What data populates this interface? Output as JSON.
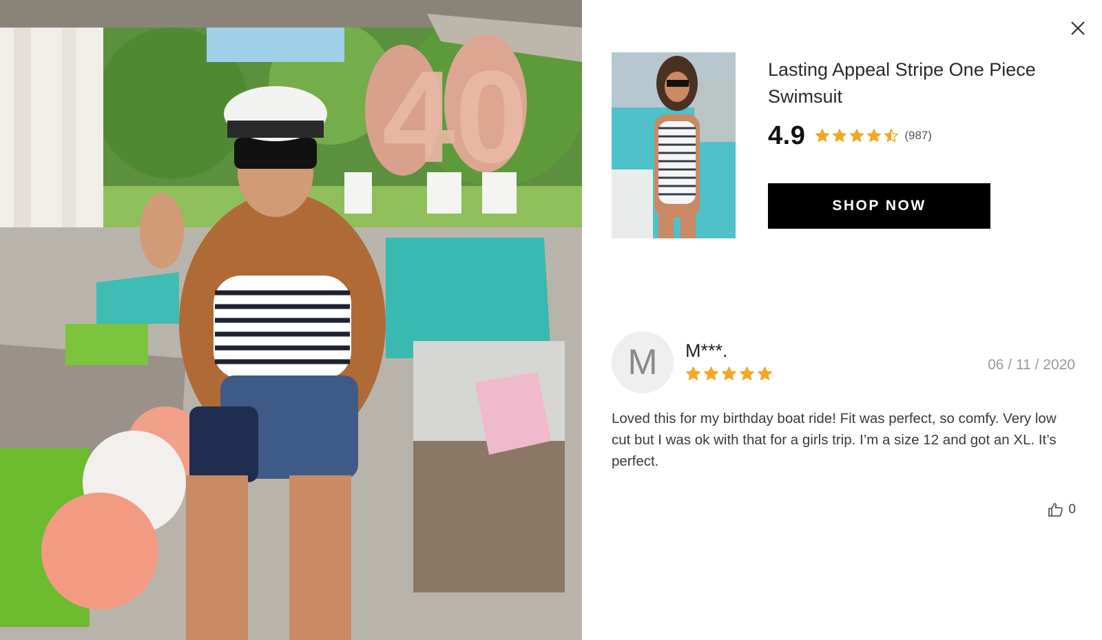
{
  "product": {
    "title": "Lasting Appeal Stripe One Piece Swimsuit",
    "rating": "4.9",
    "rating_stars": 4.5,
    "review_count": "(987)",
    "cta_label": "SHOP NOW"
  },
  "review": {
    "avatar_initial": "M",
    "reviewer": "M***.",
    "stars": 5,
    "date": "06 / 11 / 2020",
    "body": "Loved this for my birthday boat ride! Fit was perfect, so comfy. Very low cut but I was ok with that for a girls trip. I’m a size 12 and got an XL. It’s perfect.",
    "likes": "0"
  },
  "photo": {
    "balloon_text": "40"
  },
  "colors": {
    "star": "#f5a623",
    "button_bg": "#000000",
    "button_text": "#ffffff",
    "date_text": "#999999"
  },
  "icons": {
    "close": "close-icon",
    "like": "thumbs-up-icon",
    "star": "star-icon"
  }
}
